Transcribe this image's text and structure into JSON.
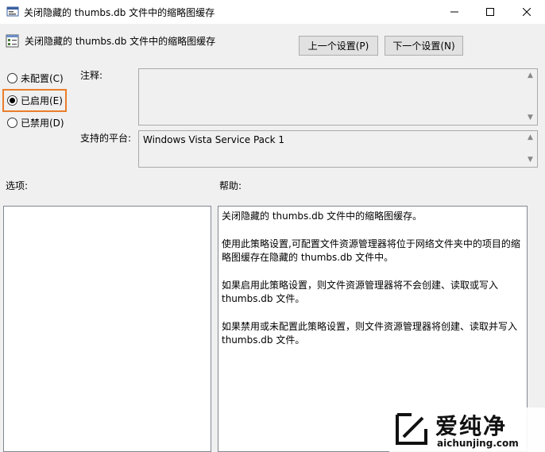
{
  "window": {
    "title": "关闭隐藏的 thumbs.db 文件中的缩略图缓存"
  },
  "header": {
    "title": "关闭隐藏的 thumbs.db 文件中的缩略图缓存",
    "prev_button": "上一个设置(P)",
    "next_button": "下一个设置(N)"
  },
  "radios": [
    {
      "label": "未配置(C)",
      "checked": false
    },
    {
      "label": "已启用(E)",
      "checked": true
    },
    {
      "label": "已禁用(D)",
      "checked": false
    }
  ],
  "comment": {
    "label": "注释:",
    "value": ""
  },
  "platform": {
    "label": "支持的平台:",
    "value": "Windows Vista Service Pack 1"
  },
  "options": {
    "label": "选项:"
  },
  "help": {
    "label": "帮助:",
    "paragraphs": [
      "关闭隐藏的 thumbs.db 文件中的缩略图缓存。",
      "使用此策略设置,可配置文件资源管理器将位于网络文件夹中的项目的缩略图缓存在隐藏的 thumbs.db 文件中。",
      "如果启用此策略设置，则文件资源管理器将不会创建、读取或写入 thumbs.db 文件。",
      "如果禁用或未配置此策略设置，则文件资源管理器将创建、读取并写入 thumbs.db 文件。"
    ]
  },
  "watermark": {
    "chinese": "爱纯净",
    "url": "aichunjing.com"
  },
  "colors": {
    "highlight": "#e97d2b",
    "background": "#f0f0f0"
  }
}
